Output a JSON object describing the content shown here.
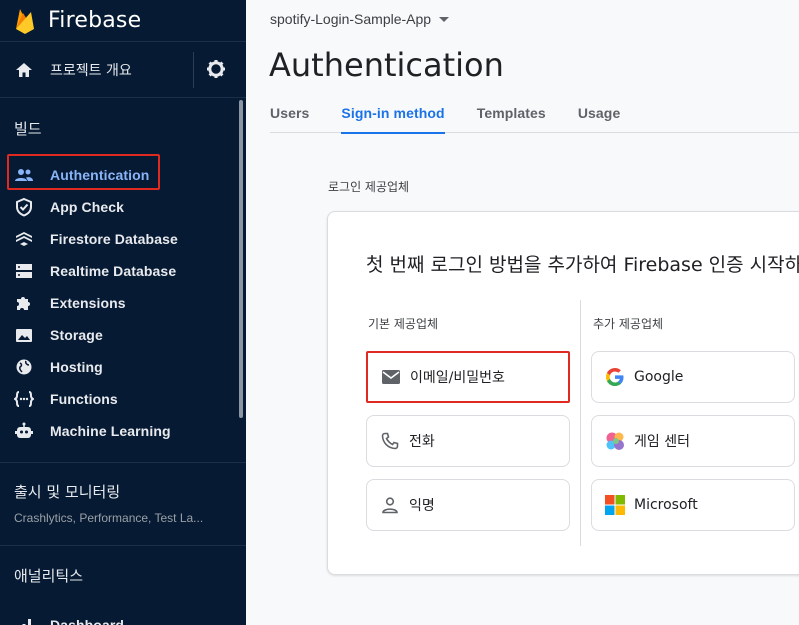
{
  "sidebar": {
    "brand": "Firebase",
    "overview_label": "프로젝트 개요",
    "build_section": "빌드",
    "items": [
      {
        "label": "Authentication",
        "icon": "people-icon",
        "active": true
      },
      {
        "label": "App Check",
        "icon": "shield-check-icon"
      },
      {
        "label": "Firestore Database",
        "icon": "firestore-icon"
      },
      {
        "label": "Realtime Database",
        "icon": "database-icon"
      },
      {
        "label": "Extensions",
        "icon": "puzzle-icon"
      },
      {
        "label": "Storage",
        "icon": "image-folder-icon"
      },
      {
        "label": "Hosting",
        "icon": "globe-icon"
      },
      {
        "label": "Functions",
        "icon": "functions-icon"
      },
      {
        "label": "Machine Learning",
        "icon": "robot-icon"
      }
    ],
    "release_section": "출시 및 모니터링",
    "release_sub": "Crashlytics, Performance, Test La...",
    "analytics_section": "애널리틱스",
    "dashboard_label": "Dashboard"
  },
  "header": {
    "project_name": "spotify-Login-Sample-App",
    "title": "Authentication",
    "tabs": [
      {
        "label": "Users"
      },
      {
        "label": "Sign-in method",
        "active": true
      },
      {
        "label": "Templates"
      },
      {
        "label": "Usage"
      }
    ]
  },
  "providers": {
    "section_label": "로그인 제공업체",
    "card_title": "첫 번째 로그인 방법을 추가하여 Firebase 인증 시작하기",
    "native_label": "기본 제공업체",
    "additional_label": "추가 제공업체",
    "native": [
      {
        "label": "이메일/비밀번호",
        "icon": "mail-icon"
      },
      {
        "label": "전화",
        "icon": "phone-icon"
      },
      {
        "label": "익명",
        "icon": "person-icon"
      }
    ],
    "additional": [
      {
        "label": "Google",
        "icon": "google-icon"
      },
      {
        "label": "게임 센터",
        "icon": "game-center-icon"
      },
      {
        "label": "Microsoft",
        "icon": "microsoft-icon"
      }
    ]
  },
  "colors": {
    "sidebar_bg": "#061a33",
    "accent": "#1a73e8",
    "active_nav": "#8ab4f8",
    "highlight": "#e0291f"
  }
}
